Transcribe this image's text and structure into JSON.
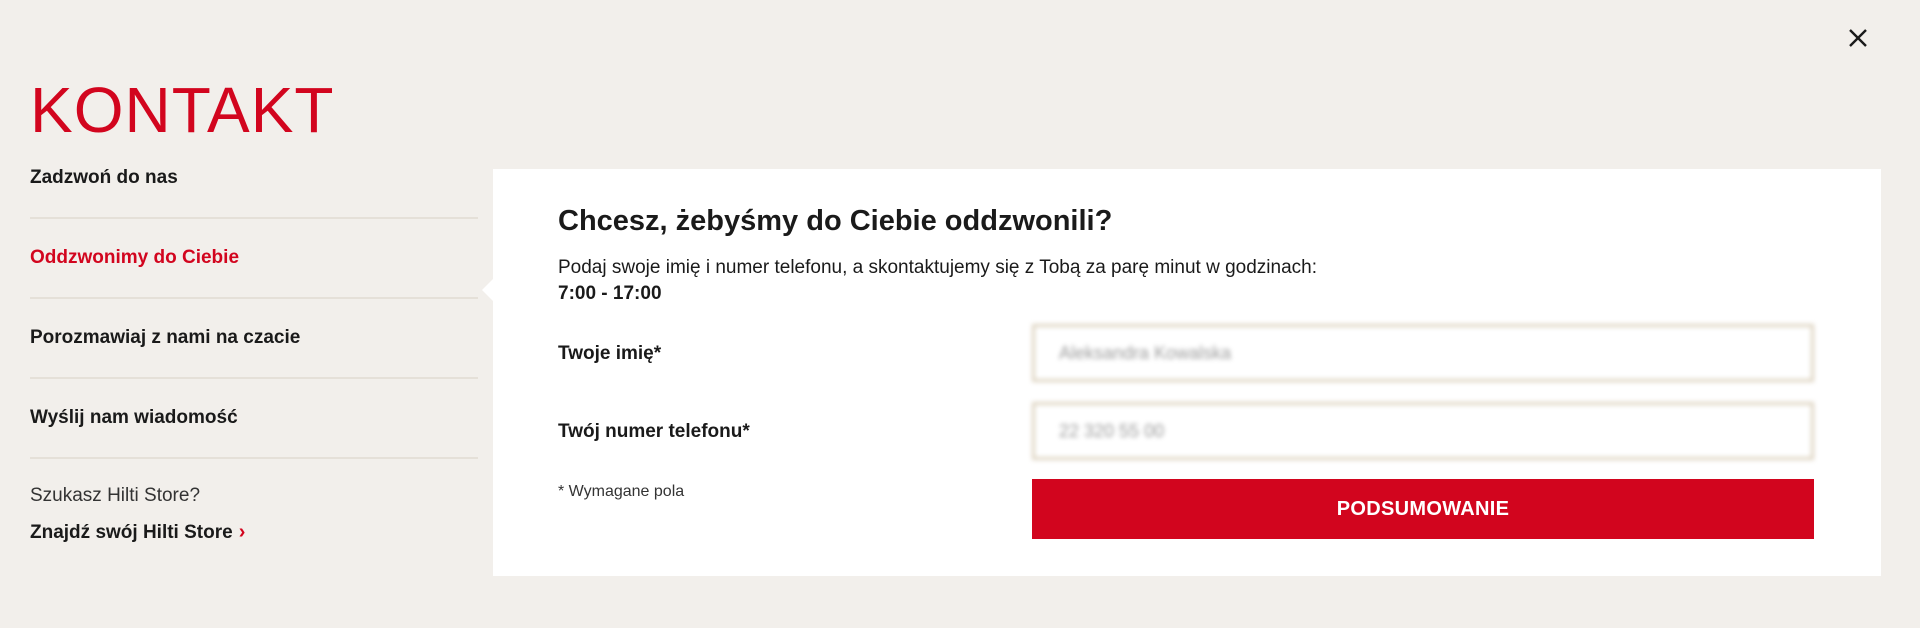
{
  "page": {
    "title": "KONTAKT"
  },
  "sidebar": {
    "items": [
      {
        "label": "Zadzwoń do nas",
        "active": false
      },
      {
        "label": "Oddzwonimy do Ciebie",
        "active": true
      },
      {
        "label": "Porozmawiaj z nami na czacie",
        "active": false
      },
      {
        "label": "Wyślij nam wiadomość",
        "active": false
      }
    ],
    "store_question": "Szukasz Hilti Store?",
    "store_link": "Znajdź swój Hilti Store",
    "store_link_icon": "chevron-right-icon"
  },
  "form": {
    "heading": "Chcesz, żebyśmy do Ciebie oddzwonili?",
    "description": "Podaj swoje imię i numer telefonu, a skontaktujemy się z Tobą za parę minut w godzinach:",
    "hours": "7:00 - 17:00",
    "name_label": "Twoje imię*",
    "name_value": "Aleksandra Kowalska",
    "phone_label": "Twój numer telefonu*",
    "phone_value": "22 320 55 00",
    "required_note": "* Wymagane pola",
    "submit_label": "PODSUMOWANIE"
  },
  "colors": {
    "accent": "#d2051e",
    "background": "#f2efeb",
    "input_border": "#ddd3c0"
  },
  "icons": {
    "close": "close-icon"
  }
}
